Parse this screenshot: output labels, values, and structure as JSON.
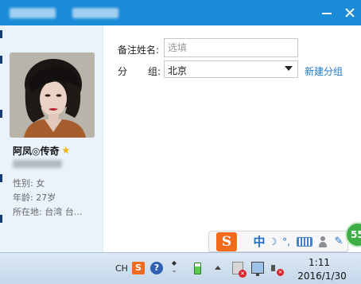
{
  "titlebar": {
    "color": "#1a8bd6",
    "icons": [
      "minimize-icon",
      "close-icon"
    ]
  },
  "profile": {
    "nickname": "阿凤◎传奇",
    "star_icon": "★",
    "sex": "性别: 女",
    "age": "年龄: 27岁",
    "location": "所在地: 台湾  台..."
  },
  "form": {
    "remark_label": "备注姓名:",
    "remark_placeholder": "选填",
    "remark_value": "",
    "group_label_1": "分",
    "group_label_2": "组:",
    "group_value": "北京",
    "new_group_link": "新建分组",
    "link_color": "#1f79c4"
  },
  "ime": {
    "logo": "S",
    "mode": "中",
    "moon": "☽",
    "punct": "°,",
    "wrench": "🔧",
    "brand_color": "#f26a1b"
  },
  "badge": {
    "count": "55"
  },
  "taskbar": {
    "lang": "CH",
    "sogou": "S",
    "help": "?",
    "ime_small": "♦ ⊕",
    "time": "1:11",
    "date": "2016/1/30"
  }
}
